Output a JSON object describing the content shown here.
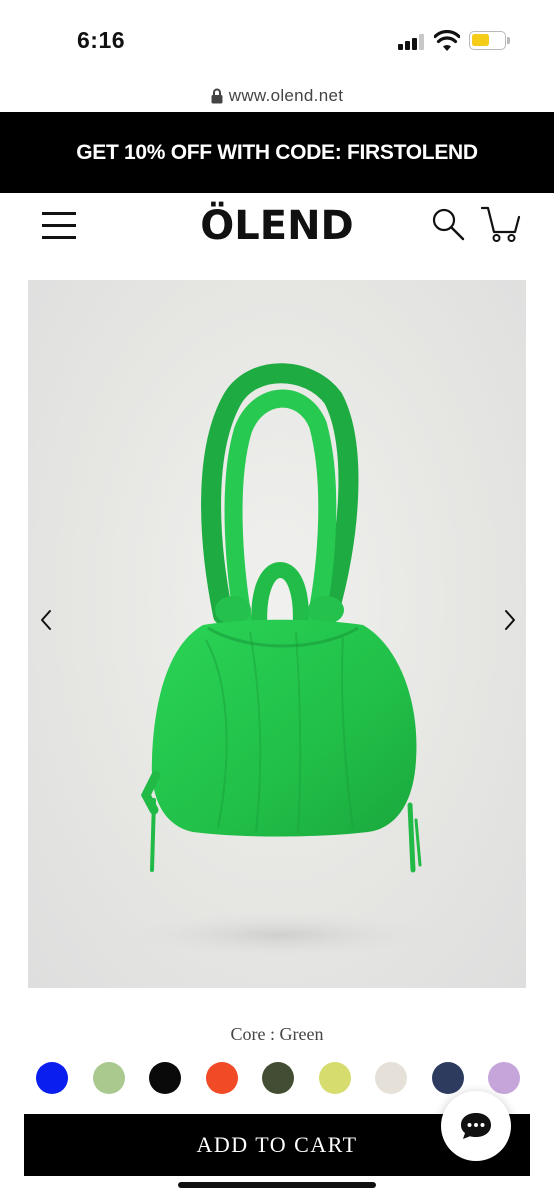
{
  "status_bar": {
    "time": "6:16"
  },
  "browser": {
    "url": "www.olend.net"
  },
  "promo": {
    "text": "GET 10% OFF WITH CODE: FIRSTOLEND"
  },
  "header": {
    "logo": "ÖLEND"
  },
  "product": {
    "variant_label": "Core : Green",
    "swatches": [
      {
        "name": "blue",
        "color": "#0a1ef0"
      },
      {
        "name": "sage",
        "color": "#a9c98f"
      },
      {
        "name": "black",
        "color": "#0a0a0a"
      },
      {
        "name": "red-orange",
        "color": "#f04a26"
      },
      {
        "name": "olive",
        "color": "#434d33"
      },
      {
        "name": "lime",
        "color": "#d6dc6e"
      },
      {
        "name": "cream",
        "color": "#e6e1d8"
      },
      {
        "name": "navy",
        "color": "#2c3b5e"
      },
      {
        "name": "lilac",
        "color": "#c6a5da"
      }
    ],
    "add_to_cart_label": "ADD TO CART",
    "bag_color": "#23c04c"
  },
  "icons": {
    "menu": "hamburger-menu-icon",
    "search": "search-icon",
    "cart": "cart-icon",
    "prev": "chevron-left-icon",
    "next": "chevron-right-icon",
    "chat": "chat-bubble-icon",
    "lock": "lock-icon"
  }
}
